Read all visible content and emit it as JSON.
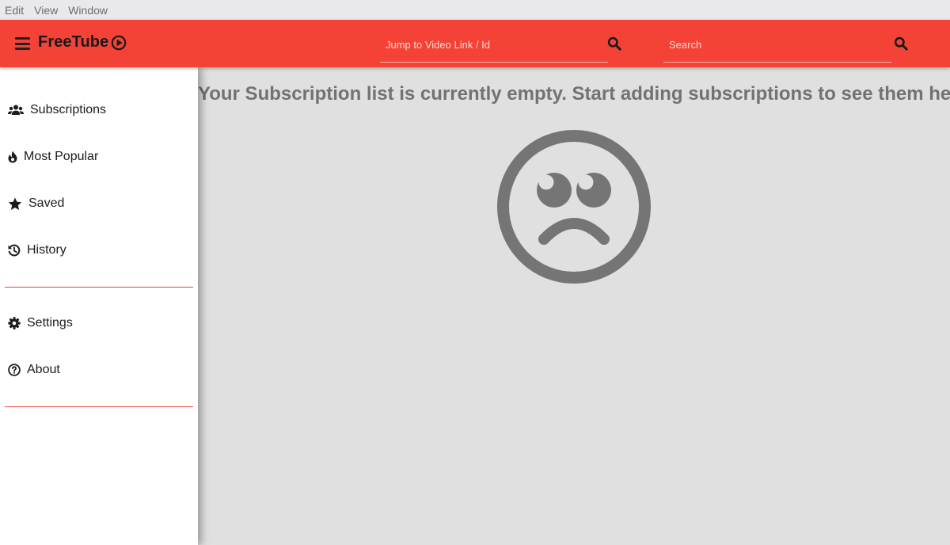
{
  "menubar": {
    "items": [
      {
        "label": "Edit"
      },
      {
        "label": "View"
      },
      {
        "label": "Window"
      }
    ]
  },
  "topnav": {
    "logo_text": "FreeTube",
    "jump_placeholder": "Jump to Video Link / Id",
    "search_placeholder": "Search",
    "background_color": "#f44336"
  },
  "sidebar": {
    "items": [
      {
        "label": "Subscriptions",
        "icon": "users-icon"
      },
      {
        "label": "Most Popular",
        "icon": "fire-icon"
      },
      {
        "label": "Saved",
        "icon": "star-icon"
      },
      {
        "label": "History",
        "icon": "history-icon"
      }
    ],
    "bottom_items": [
      {
        "label": "Settings",
        "icon": "gear-icon"
      },
      {
        "label": "About",
        "icon": "question-circle-icon"
      }
    ],
    "divider_color": "#f44336"
  },
  "main": {
    "empty_message": "Your Subscription list is currently empty. Start adding subscriptions to see them here.",
    "empty_icon": "sad-face-icon"
  }
}
